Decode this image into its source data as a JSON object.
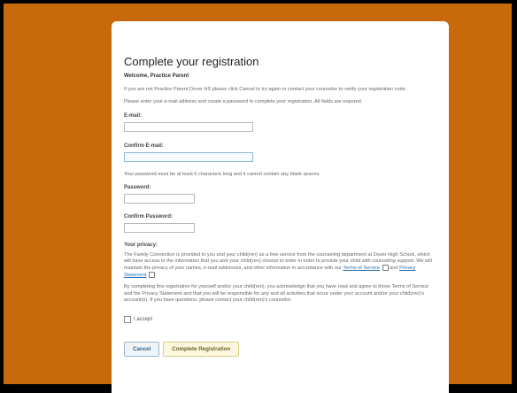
{
  "page": {
    "title": "Complete your registration",
    "welcome": "Welcome, Practice Parent",
    "intro1": "If you are not Practice Parent Dover HS please click Cancel to try again or contact your counselor to verify your registration code.",
    "intro2": "Please enter your e-mail address and create a password to complete your registration. All fields are required."
  },
  "form": {
    "email_label": "E-mail:",
    "email_value": "",
    "confirm_email_label": "Confirm E-mail:",
    "confirm_email_value": "",
    "password_hint": "Your password must be at least 6 characters long and it cannot contain any blank spaces.",
    "password_label": "Password:",
    "password_value": "",
    "confirm_password_label": "Confirm Password:",
    "confirm_password_value": ""
  },
  "privacy": {
    "heading": "Your privacy:",
    "para1_text": "The Family Connection is provided to you and your child(ren) as a free service from the counseling department at Dover High School, which will have access to the information that you and your child(ren) choose to enter in order to provide your child with counseling support. We will maintain the privacy of your names, e-mail addresses, and other information in accordance with our",
    "terms_link": "Terms of Service",
    "and_text": "and",
    "privacy_link": "Privacy Statement",
    "para2": "By completing this registration for yourself and/or your child(ren), you acknowledge that you have read and agree to those Terms of Service and the Privacy Statement and that you will be responsible for any and all activities that occur under your account and/or your child(ren)'s account(s). If you have questions, please contact your child(ren)'s counselor."
  },
  "accept": {
    "label": "I accept",
    "checked": false
  },
  "buttons": {
    "cancel": "Cancel",
    "submit": "Complete Registration"
  },
  "icons": {
    "external": "external-window-icon",
    "checkbox": "checkbox-icon"
  }
}
